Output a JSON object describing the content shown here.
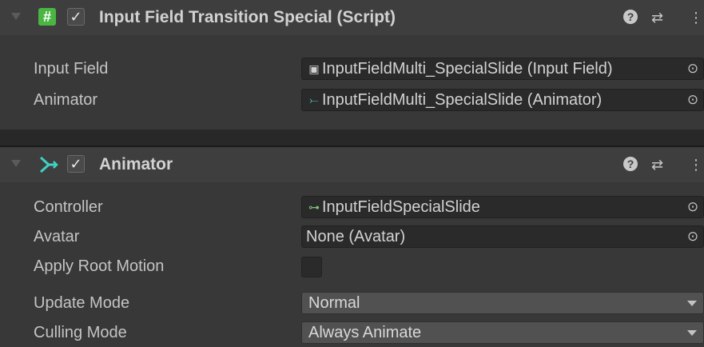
{
  "component1": {
    "title": "Input Field Transition Special (Script)",
    "enabled": true,
    "fields": [
      {
        "label": "Input Field",
        "value": "InputFieldMulti_SpecialSlide (Input Field)",
        "icon": "input-field-icon"
      },
      {
        "label": "Animator",
        "value": "InputFieldMulti_SpecialSlide (Animator)",
        "icon": "animator-icon"
      }
    ]
  },
  "component2": {
    "title": "Animator",
    "enabled": true,
    "controller": {
      "label": "Controller",
      "value": "InputFieldSpecialSlide",
      "icon": "animator-controller-icon"
    },
    "avatar": {
      "label": "Avatar",
      "value": "None (Avatar)"
    },
    "apply_root_motion": {
      "label": "Apply Root Motion",
      "checked": false
    },
    "update_mode": {
      "label": "Update Mode",
      "value": "Normal"
    },
    "culling_mode": {
      "label": "Culling Mode",
      "value": "Always Animate"
    }
  },
  "icons": {
    "help": "?",
    "check": "✓",
    "script": "#",
    "picker": "⊙"
  },
  "colors": {
    "script_icon": "#4bb543",
    "animator_icon": "#3fd1c4",
    "background": "#383838",
    "header": "#3e3e3e"
  }
}
